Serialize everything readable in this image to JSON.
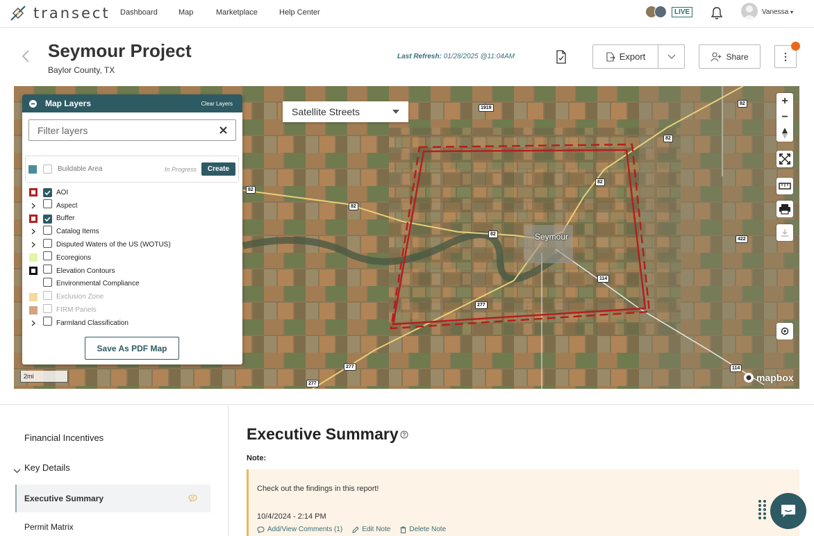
{
  "nav": {
    "logo": "transect",
    "links": [
      "Dashboard",
      "Map",
      "Marketplace",
      "Help Center"
    ],
    "live_badge": "LIVE",
    "username": "Vanessa"
  },
  "header": {
    "title": "Seymour Project",
    "subtitle": "Baylor County, TX",
    "last_refresh_label": "Last Refresh:",
    "last_refresh_value": "01/28/2025 @11:04AM",
    "export_label": "Export",
    "share_label": "Share"
  },
  "map": {
    "style_select": "Satellite Streets",
    "scale": "2mi",
    "attribution": "mapbox",
    "town": "Seymour",
    "route_shields": [
      "1919",
      "82",
      "82",
      "82",
      "82",
      "82",
      "82",
      "422",
      "114",
      "114",
      "277",
      "277",
      "277"
    ]
  },
  "layers_panel": {
    "title": "Map Layers",
    "clear_label": "Clear Layers",
    "filter_placeholder": "Filter layers",
    "buildable": {
      "label": "Buildable Area",
      "status": "In Progress",
      "action": "Create",
      "color": "#4b8c9b"
    },
    "items": [
      {
        "label": "AOI",
        "checked": true,
        "expand": false,
        "swatch": "aoi"
      },
      {
        "label": "Aspect",
        "checked": false,
        "expand": true,
        "swatch": ""
      },
      {
        "label": "Buffer",
        "checked": true,
        "expand": false,
        "swatch": "buffer"
      },
      {
        "label": "Catalog Items",
        "checked": false,
        "expand": true,
        "swatch": ""
      },
      {
        "label": "Disputed Waters of the US (WOTUS)",
        "checked": false,
        "expand": true,
        "swatch": ""
      },
      {
        "label": "Ecoregions",
        "checked": false,
        "expand": false,
        "swatch": "eco"
      },
      {
        "label": "Elevation Contours",
        "checked": false,
        "expand": false,
        "swatch": "contour"
      },
      {
        "label": "Environmental Compliance",
        "checked": false,
        "expand": false,
        "swatch": ""
      },
      {
        "label": "Exclusion Zone",
        "checked": false,
        "expand": false,
        "swatch": "exclusion",
        "disabled": true
      },
      {
        "label": "FIRM Panels",
        "checked": false,
        "expand": false,
        "swatch": "firm",
        "disabled": true
      },
      {
        "label": "Farmland Classification",
        "checked": false,
        "expand": true,
        "swatch": ""
      }
    ],
    "pdf_button": "Save As PDF Map"
  },
  "sidebar": {
    "items": [
      "Financial Incentives",
      "Key Details",
      "Executive Summary",
      "Permit Matrix"
    ]
  },
  "summary": {
    "title": "Executive Summary",
    "note_label": "Note:",
    "note_text": "Check out the findings in this report!",
    "note_time": "10/4/2024 - 2:14 PM",
    "actions": [
      "Add/View Comments (1)",
      "Edit Note",
      "Delete Note"
    ]
  },
  "colors": {
    "primary": "#2e5a63",
    "accent": "#e86b1a",
    "aoi": "#b3201f"
  }
}
